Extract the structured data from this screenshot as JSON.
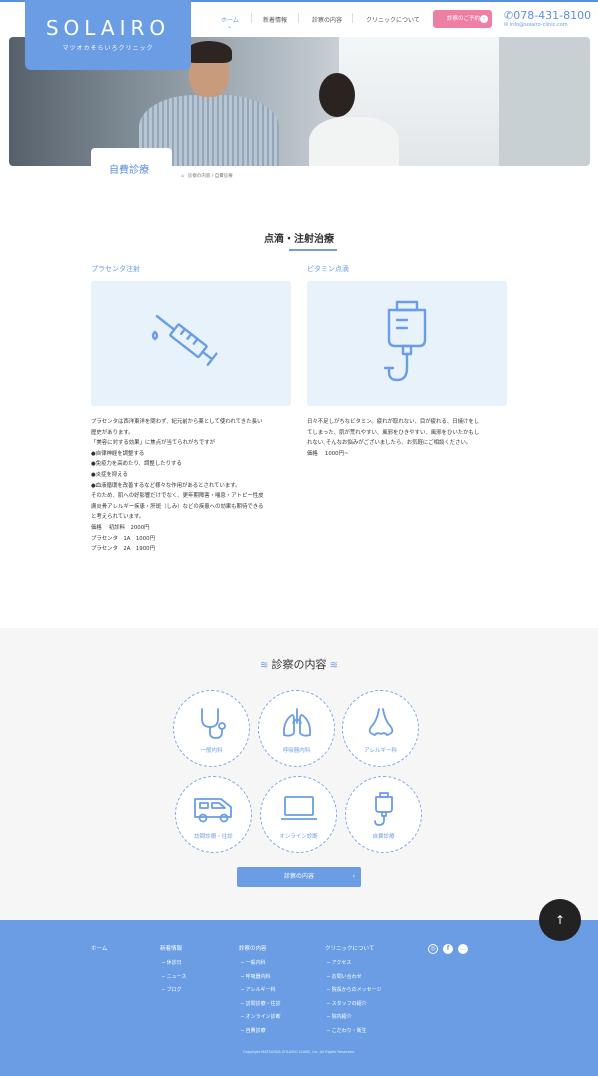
{
  "header": {
    "logo_name": "SOLAIRO",
    "logo_sub": "マツオカそらいろクリニック",
    "nav": [
      "ホーム",
      "新着情報",
      "診察の内容",
      "クリニックについて"
    ],
    "nav_chevron": "⌄",
    "reserve": "診察のご予約",
    "reserve_arrow": "›",
    "phone": "078-431-8100",
    "email": "info@solairo-clinic.com"
  },
  "page": {
    "title": "自費診療",
    "breadcrumb": [
      "診察の内容",
      "自費診療"
    ],
    "breadcrumb_sep": " / "
  },
  "section": {
    "title": "点滴・注射治療",
    "cards": [
      {
        "title": "プラセンタ注射",
        "icon": "syringe-icon",
        "desc": [
          "プラセンタは西洋東洋を問わず、紀元前から薬として使われてきた長い",
          "歴史があります。",
          "「美容に対する効果」に焦点が当てられがちですが",
          "●自律神経を調整する",
          "●免疫力を高めたり、調整したりする",
          "●炎症を抑える",
          "●血液循環を改善するなど様々な作用があるとされています。",
          "そのため、肌への好影響だけでなく、更年期障害・喘息・アトピー性皮",
          "膚炎骨アレルギー疾患・肝斑（しみ）などの疾患への効果も期待できる",
          "と考えられています。",
          "",
          "価格　 初診料　2000円",
          "プラセンタ　1A　1000円",
          "プラセンタ　2A　1900円"
        ]
      },
      {
        "title": "ビタミン点滴",
        "icon": "iv-drip-icon",
        "desc": [
          "日々不足しがちなビタミン。疲れが取れない、目が疲れる、日焼けをし",
          "てしまった、肌が荒れやすい、風邪をひきやすい、風邪をひいたかもし",
          "れない､そんなお悩みがございましたら、お気軽にご相談ください。",
          "",
          "価格　 1000円~"
        ]
      }
    ]
  },
  "services": {
    "title": "診察の内容",
    "items": [
      {
        "label": "一般内科",
        "icon": "stethoscope-icon"
      },
      {
        "label": "呼吸器内科",
        "icon": "lungs-icon"
      },
      {
        "label": "アレルギー科",
        "icon": "nose-icon"
      },
      {
        "label": "訪問診療・往診",
        "icon": "car-icon"
      },
      {
        "label": "オンライン診断",
        "icon": "laptop-icon"
      },
      {
        "label": "自費診療",
        "icon": "iv-drip-icon"
      }
    ],
    "button": "診察の内容",
    "button_arrow": "›"
  },
  "footer": {
    "columns": [
      {
        "head": "ホーム",
        "items": []
      },
      {
        "head": "新着情報",
        "items": [
          "休診日",
          "ニュース",
          "ブログ"
        ]
      },
      {
        "head": "診察の内容",
        "items": [
          "一般内科",
          "呼吸器内科",
          "アレルギー科",
          "訪問診療・往診",
          "オンライン診断",
          "自費診療"
        ]
      },
      {
        "head": "クリニックについて",
        "items": [
          "アクセス",
          "お問い合わせ",
          "院長からのメッセージ",
          "スタッフの紹介",
          "院内紹介",
          "こだわり・衛生"
        ]
      }
    ],
    "item_prefix": "─",
    "social": [
      "instagram-icon",
      "facebook-icon",
      "line-icon"
    ],
    "social_glyphs": [
      "◎",
      "f",
      "…"
    ],
    "copyright": "Copyright MATSUOKA SOLAIRO CLINIC, Inc. All Rights Reserved."
  },
  "pagetop": "↑",
  "colors": {
    "primary": "#6a9de3",
    "pink": "#ee7ea3",
    "light_bg": "#e8f2fb"
  }
}
